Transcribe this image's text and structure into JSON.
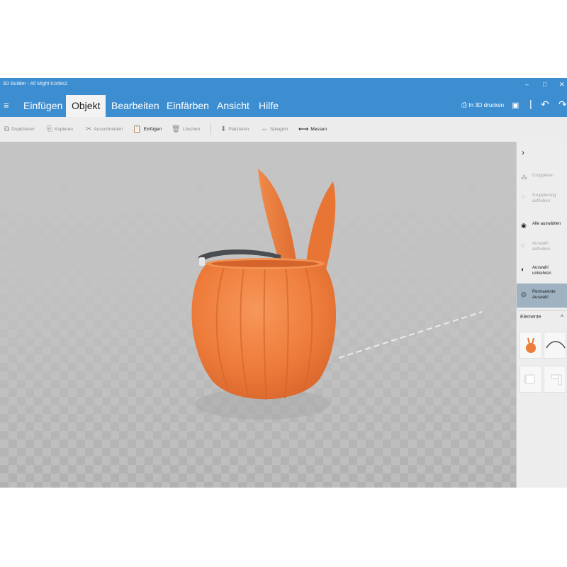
{
  "window": {
    "title": "3D Builder - All Might Kürbis2",
    "minimize": "–",
    "maximize": "□",
    "close": "✕"
  },
  "menu": {
    "tabs": [
      {
        "label": "Einfügen"
      },
      {
        "label": "Objekt"
      },
      {
        "label": "Bearbeiten"
      },
      {
        "label": "Einfärben"
      },
      {
        "label": "Ansicht"
      },
      {
        "label": "Hilfe"
      }
    ],
    "print_3d": "In 3D drucken"
  },
  "toolbar": {
    "duplicate": "Duplizieren",
    "copy": "Kopieren",
    "cut": "Ausschneiden",
    "paste": "Einfügen",
    "delete": "Löschen",
    "place": "Platzieren",
    "mirror": "Spiegeln",
    "measure": "Messen"
  },
  "right_panel": {
    "collapse": "›",
    "group": "Gruppieren",
    "ungroup": "Gruppierung aufheben",
    "select_all": "Alle auswählen",
    "deselect": "Auswahl aufheben",
    "invert": "Auswahl umkehren",
    "permanent": "Permanente Auswahl",
    "elements_title": "Elemente",
    "elements_toggle": "^"
  },
  "colors": {
    "accent": "#3d8ed1",
    "object": "#ee7c3b",
    "viewport": "#b9b9b9"
  }
}
